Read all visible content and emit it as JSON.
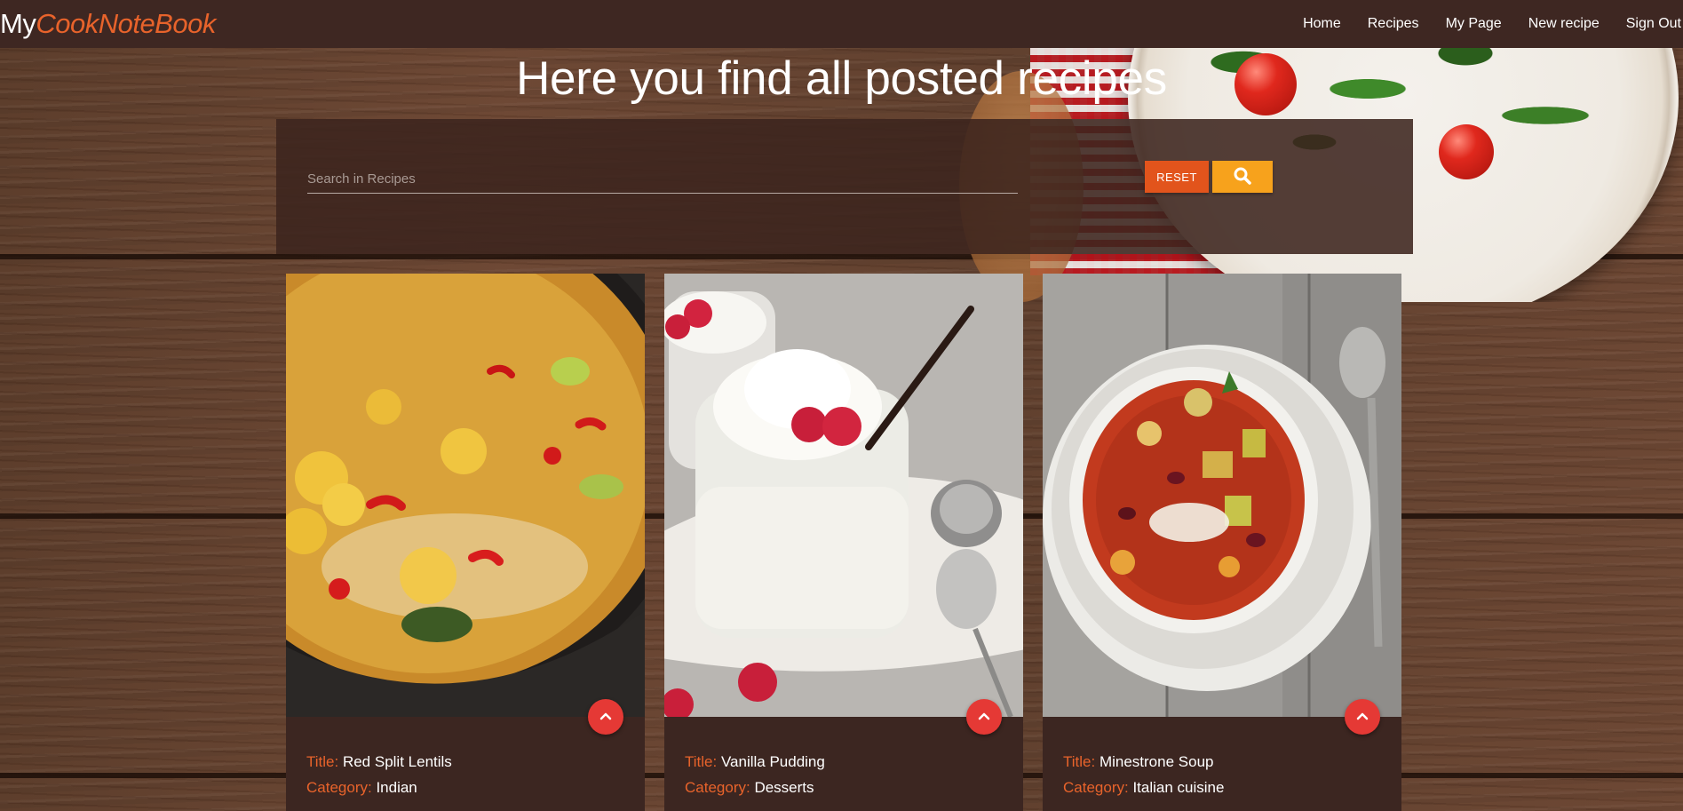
{
  "navbar": {
    "brand_my": "My",
    "brand_cook": "CookNoteBook",
    "links": [
      "Home",
      "Recipes",
      "My Page",
      "New recipe",
      "Sign Out"
    ]
  },
  "page_title": "Here you find all posted recipes",
  "search": {
    "placeholder": "Search in Recipes",
    "reset_label": "RESET",
    "search_icon": "search-icon"
  },
  "labels": {
    "title": "Title:",
    "category": "Category:"
  },
  "recipes": [
    {
      "title": "Red Split Lentils",
      "category": "Indian"
    },
    {
      "title": "Vanilla Pudding",
      "category": "Desserts"
    },
    {
      "title": "Minestrone Soup",
      "category": "Italian cuisine"
    }
  ],
  "colors": {
    "navbar_bg": "#3e2722",
    "accent_orange": "#e8632b",
    "reset_button": "#e2541c",
    "search_button": "#f7a21c",
    "toggle_button": "#e53935",
    "card_bg": "#3c2621"
  }
}
